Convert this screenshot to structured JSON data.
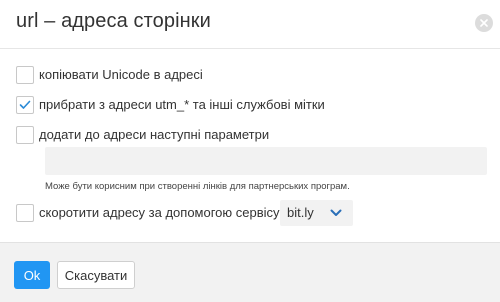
{
  "dialog": {
    "title": "url – адреса сторінки",
    "close_icon": "close-icon"
  },
  "options": {
    "copy_unicode": {
      "label": "копіювати Unicode в адресі",
      "checked": false
    },
    "remove_utm": {
      "label": "прибрати з адреси utm_* та інші службові мітки",
      "checked": true
    },
    "add_params": {
      "label": "додати до адреси наступні параметри",
      "checked": false,
      "input_value": "",
      "hint": "Може бути корисним при створенні лінків для партнерських програм."
    },
    "shorten": {
      "label": "скоротити адресу за допомогою сервісу",
      "checked": false,
      "service": "bit.ly"
    }
  },
  "footer": {
    "ok_label": "Ok",
    "cancel_label": "Скасувати"
  },
  "colors": {
    "accent": "#2196f3",
    "check": "#2a8ad6",
    "footer_bg": "#f2f2f2"
  }
}
